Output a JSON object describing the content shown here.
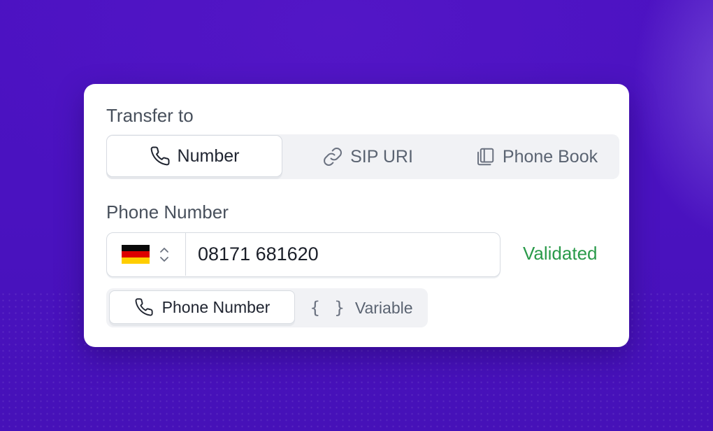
{
  "transfer": {
    "label": "Transfer to",
    "tabs": [
      {
        "label": "Number",
        "icon": "phone-icon",
        "active": true
      },
      {
        "label": "SIP URI",
        "icon": "link-icon",
        "active": false
      },
      {
        "label": "Phone Book",
        "icon": "book-icon",
        "active": false
      }
    ]
  },
  "phone": {
    "label": "Phone Number",
    "country": {
      "flag": "germany-flag-icon",
      "colors": [
        "#0a0a0a",
        "#dd0000",
        "#ffce00"
      ]
    },
    "value": "08171 681620",
    "status": "Validated",
    "status_color": "#2a9a4a"
  },
  "input_type": {
    "options": [
      {
        "label": "Phone Number",
        "icon": "phone-icon",
        "active": true
      },
      {
        "label": "Variable",
        "icon": "braces-icon",
        "glyph": "{ }",
        "active": false
      }
    ]
  },
  "colors": {
    "background": "#4c12c2",
    "card": "#ffffff",
    "accent_valid": "#2a9a4a"
  }
}
